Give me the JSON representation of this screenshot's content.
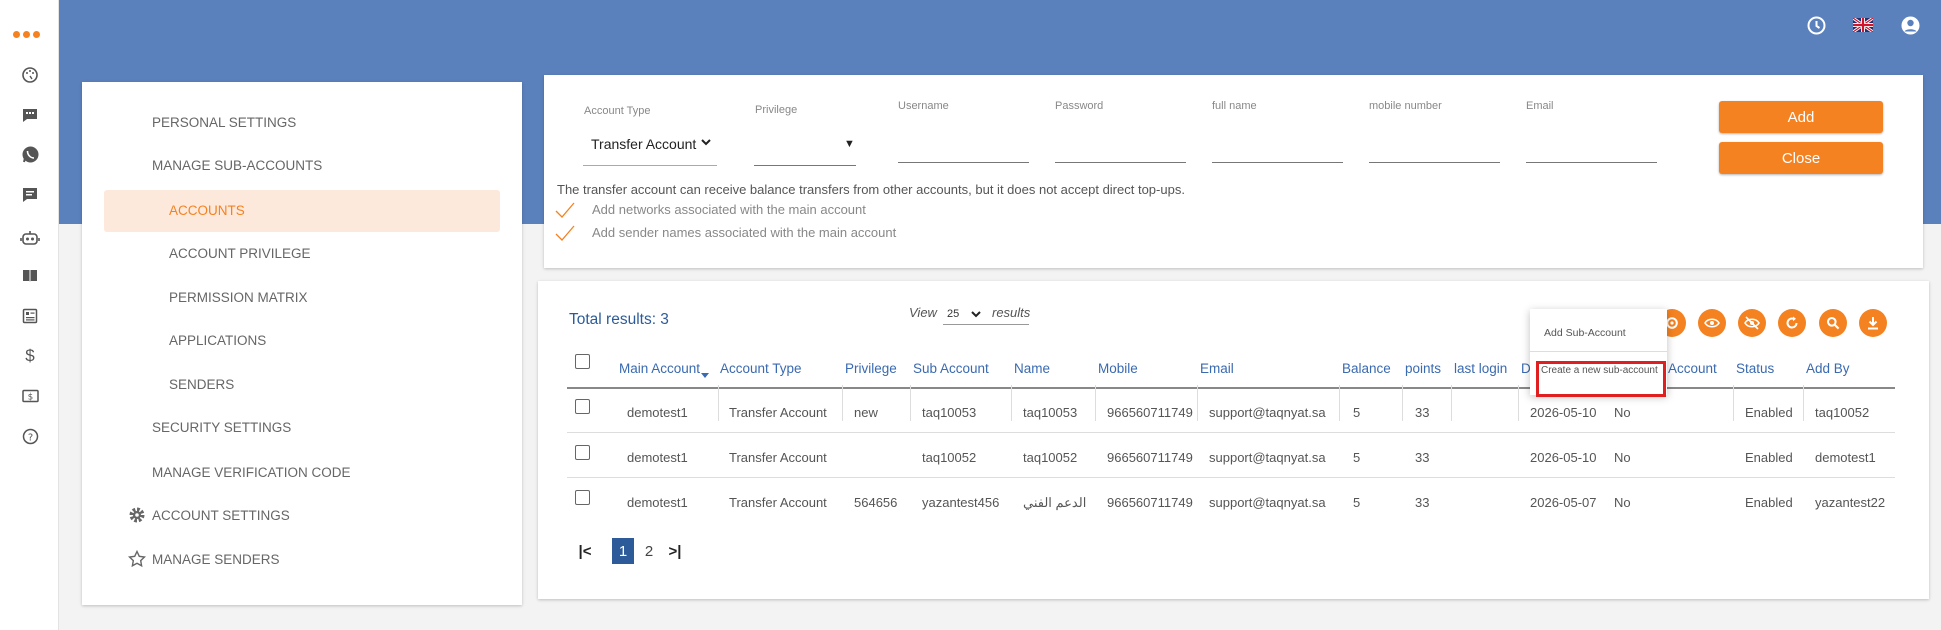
{
  "sidebar_rail": {
    "icons": [
      "dashboard-icon",
      "chat-icon",
      "whatsapp-icon",
      "message-icon",
      "bot-icon",
      "book-icon",
      "report-icon",
      "dollar-icon",
      "billing-icon",
      "help-icon"
    ]
  },
  "topbar": {
    "icons": [
      "clock-icon",
      "uk-flag-icon",
      "user-account-icon"
    ]
  },
  "menu": {
    "personal_settings": "PERSONAL SETTINGS",
    "manage_sub_accounts": "MANAGE SUB-ACCOUNTS",
    "accounts": "ACCOUNTS",
    "account_privilege": "ACCOUNT PRIVILEGE",
    "permission_matrix": "PERMISSION MATRIX",
    "applications": "APPLICATIONS",
    "senders": "SENDERS",
    "security_settings": "SECURITY SETTINGS",
    "manage_verification_code": "MANAGE VERIFICATION CODE",
    "account_settings": "ACCOUNT SETTINGS",
    "manage_senders": "MANAGE SENDERS"
  },
  "form": {
    "account_type_label": "Account Type",
    "account_type_value": "Transfer Account",
    "privilege_label": "Privilege",
    "username_label": "Username",
    "password_label": "Password",
    "fullname_label": "full name",
    "mobile_label": "mobile number",
    "email_label": "Email",
    "add_label": "Add",
    "close_label": "Close",
    "note": "The transfer account can receive balance transfers from other accounts, but it does not accept direct top-ups.",
    "check1": "Add networks associated with the main account",
    "check2": "Add sender names associated with the main account"
  },
  "table": {
    "total": "Total results: 3",
    "view_label": "View",
    "page_size": "25",
    "results_label": "results",
    "popup_add": "Add Sub-Account",
    "popup_create": "Create a new sub-account",
    "headers": {
      "main_account": "Main Account",
      "account_type": "Account Type",
      "privilege": "Privilege",
      "sub_account": "Sub Account",
      "name": "Name",
      "mobile": "Mobile",
      "email": "Email",
      "balance": "Balance",
      "points": "points",
      "last_login": "last login",
      "d": "D",
      "account": "Account",
      "status": "Status",
      "add_by": "Add By"
    },
    "rows": [
      {
        "main": "demotest1",
        "type": "Transfer Account",
        "privilege": "new",
        "sub": "taq10053",
        "name": "taq10053",
        "mobile": "966560711749",
        "email": "support@taqnyat.sa",
        "balance": "5",
        "points": "33",
        "date": "2026-05-10",
        "account": "No",
        "status": "Enabled",
        "addby": "taq10052"
      },
      {
        "main": "demotest1",
        "type": "Transfer Account",
        "privilege": "",
        "sub": "taq10052",
        "name": "taq10052",
        "mobile": "966560711749",
        "email": "support@taqnyat.sa",
        "balance": "5",
        "points": "33",
        "date": "2026-05-10",
        "account": "No",
        "status": "Enabled",
        "addby": "demotest1"
      },
      {
        "main": "demotest1",
        "type": "Transfer Account",
        "privilege": "564656",
        "sub": "yazantest456",
        "name": "الدعم الفني",
        "mobile": "966560711749",
        "email": "support@taqnyat.sa",
        "balance": "5",
        "points": "33",
        "date": "2026-05-07",
        "account": "No",
        "status": "Enabled",
        "addby": "yazantest22"
      }
    ],
    "pagination": {
      "first": "|<",
      "page1": "1",
      "page2": "2",
      "last": ">|"
    }
  },
  "colors": {
    "accent": "#f58220",
    "banner": "#5b81bd",
    "link": "#3a6ab0",
    "active_bg": "#fde9dc"
  }
}
